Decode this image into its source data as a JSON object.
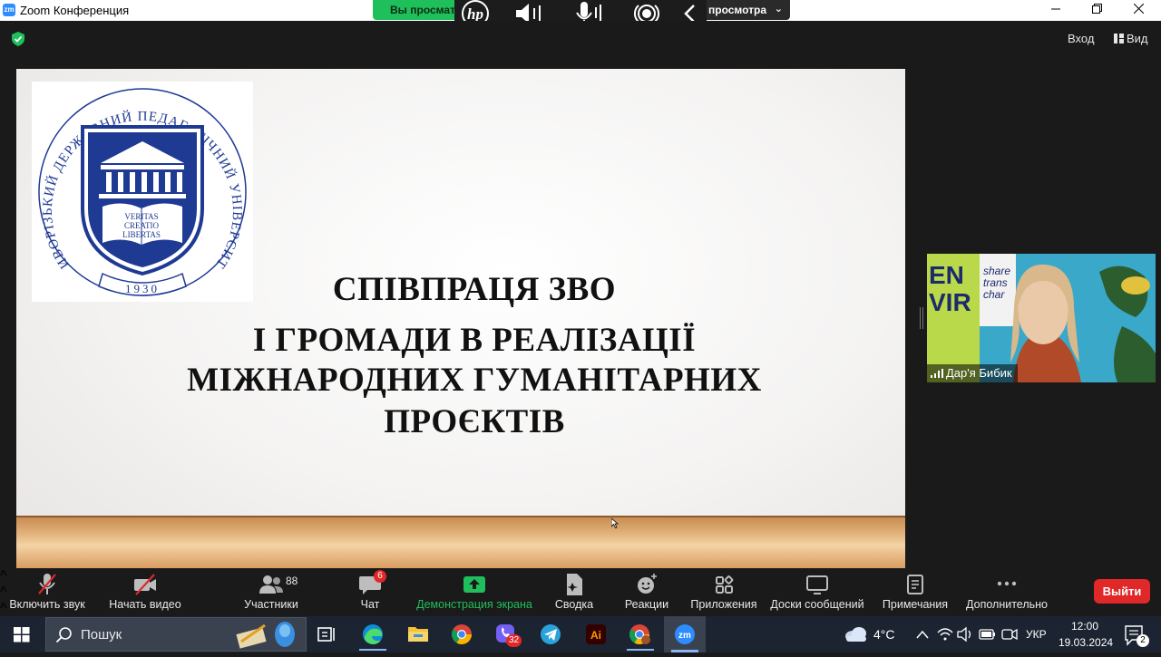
{
  "window": {
    "app_icon": "zm",
    "title": "Zoom Конференция",
    "controls": [
      "minimize-icon",
      "maximize-icon",
      "close-icon"
    ]
  },
  "view_banner": {
    "left_text": "Вы просмат",
    "right_text": "просмотра",
    "accent": "#1fbf5b"
  },
  "hp_bar": {
    "icons": [
      "hp-logo-icon",
      "speaker-mute-icon",
      "microphone-icon",
      "broadcast-icon",
      "chevron-left-icon"
    ]
  },
  "header": {
    "encryption_icon": "shield-check-icon",
    "login": "Вход",
    "view": "Вид"
  },
  "slide": {
    "logo": {
      "ring_text": "КРИВОРІЗЬКИЙ ДЕРЖАВНИЙ ПЕДАГОГІЧНИЙ УНІВЕРСИТЕТ",
      "motto": [
        "VERITAS",
        "CREATIO",
        "LIBERTAS"
      ],
      "year": "1930"
    },
    "lines": [
      "СПІВПРАЦЯ ЗВО",
      "І ГРОМАДИ В РЕАЛІЗАЦІЇ",
      "МІЖНАРОДНИХ ГУМАНІТАРНИХ",
      "ПРОЄКТІВ"
    ]
  },
  "participant_video": {
    "name": "Дар'я Бибик",
    "background_text": [
      "EN",
      "VIR",
      "share",
      "trans",
      "char"
    ],
    "signal_icon": "signal-bars-icon"
  },
  "toolbar": {
    "items": [
      {
        "label": "Включить звук",
        "icon": "microphone-muted-icon"
      },
      {
        "label": "Начать видео",
        "icon": "video-off-icon"
      },
      {
        "label": "Участники",
        "icon": "participants-icon",
        "count": "88"
      },
      {
        "label": "Чат",
        "icon": "chat-icon",
        "badge": "6"
      },
      {
        "label": "Демонстрация экрана",
        "icon": "share-screen-icon"
      },
      {
        "label": "Сводка",
        "icon": "summary-icon"
      },
      {
        "label": "Реакции",
        "icon": "reactions-icon"
      },
      {
        "label": "Приложения",
        "icon": "apps-icon"
      },
      {
        "label": "Доски сообщений",
        "icon": "whiteboards-icon"
      },
      {
        "label": "Примечания",
        "icon": "notes-icon"
      },
      {
        "label": "Дополнительно",
        "icon": "more-icon"
      }
    ],
    "leave": "Выйти",
    "share_color": "#1fbf5b",
    "leave_color": "#e02828"
  },
  "taskbar": {
    "search_placeholder": "Пошук",
    "apps": [
      "windows-start-icon",
      "search-icon",
      "task-view-icon",
      "edge-icon",
      "file-explorer-icon",
      "chrome-icon",
      "viber-icon",
      "telegram-icon",
      "illustrator-icon",
      "chrome-profile-icon",
      "zoom-icon"
    ],
    "viber_badge": "32",
    "weather": "4°C",
    "language": "УКР",
    "time": "12:00",
    "date": "19.03.2024",
    "notifications": "2"
  }
}
